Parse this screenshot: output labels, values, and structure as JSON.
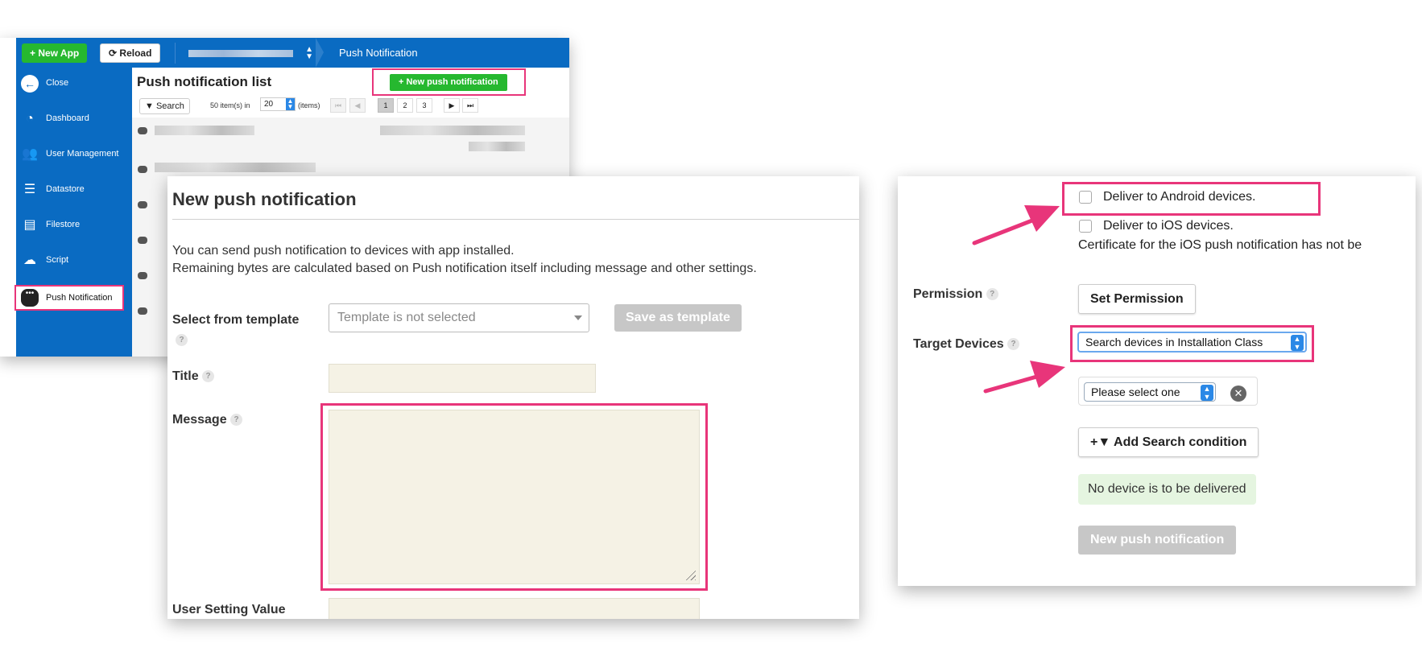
{
  "console": {
    "new_app": "+ New App",
    "reload": "Reload",
    "breadcrumb": "Push Notification",
    "sidebar": [
      {
        "label": "Close",
        "icon": "back-arrow-icon"
      },
      {
        "label": "Dashboard",
        "icon": "dashboard-icon"
      },
      {
        "label": "User Management",
        "icon": "users-icon"
      },
      {
        "label": "Datastore",
        "icon": "datastore-icon"
      },
      {
        "label": "Filestore",
        "icon": "filestore-icon"
      },
      {
        "label": "Script",
        "icon": "script-icon"
      },
      {
        "label": "Push Notification",
        "icon": "chat-bubble-icon"
      }
    ],
    "list_title": "Push notification list",
    "new_push_button": "+ New push notification",
    "search_button": "Search",
    "items_prefix": "50 item(s) in",
    "items_value": "20",
    "items_unit": "(items)",
    "pages": [
      "1",
      "2",
      "3"
    ],
    "highlight_color": "#e8357a",
    "brand_color": "#0a6bc2"
  },
  "form": {
    "title": "New push notification",
    "desc_line1": "You can send push notification to devices with app installed.",
    "desc_line2": "Remaining bytes are calculated based on Push notification itself including message and other settings.",
    "template_label": "Select from template",
    "template_placeholder": "Template is not selected",
    "save_template": "Save as template",
    "title_label": "Title",
    "message_label": "Message",
    "user_setting_label": "User Setting Value"
  },
  "delivery": {
    "android": "Deliver to Android devices.",
    "ios": "Deliver to iOS devices.",
    "cert_note": "Certificate for the iOS push notification has not be",
    "permission_label": "Permission",
    "set_permission": "Set Permission",
    "target_label": "Target Devices",
    "target_select": "Search devices in Installation Class",
    "condition_select": "Please select one",
    "add_condition": "Add Search condition",
    "no_device": "No device is to be delivered",
    "new_push": "New push notification"
  }
}
